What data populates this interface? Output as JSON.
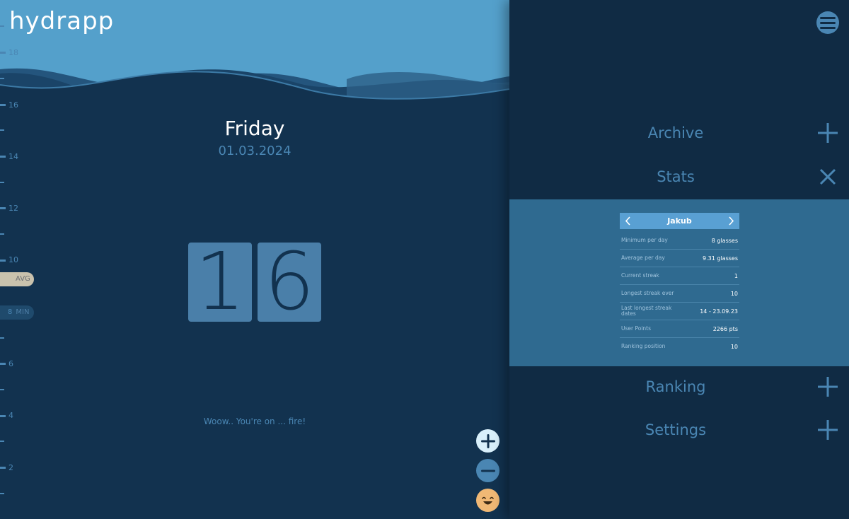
{
  "app": {
    "logo": "hydrapp"
  },
  "ruler": {
    "labels": [
      "18",
      "16",
      "14",
      "12",
      "10",
      "8",
      "6",
      "4",
      "2"
    ],
    "avg_label": "AVG",
    "min_label": "MIN"
  },
  "main": {
    "day": "Friday",
    "date": "01.03.2024",
    "count_digits": [
      "1",
      "6"
    ],
    "message": "Woow.. You're on ... fire!"
  },
  "actions": {
    "add_icon": "plus-icon",
    "remove_icon": "minus-icon",
    "mood_icon": "smiley-icon"
  },
  "menu": {
    "items": [
      {
        "label": "Archive",
        "icon": "plus-icon"
      },
      {
        "label": "Stats",
        "icon": "close-icon"
      },
      {
        "label": "Ranking",
        "icon": "plus-icon"
      },
      {
        "label": "Settings",
        "icon": "plus-icon"
      }
    ]
  },
  "stats": {
    "user": "Jakub",
    "rows": [
      {
        "key": "Minimum per day",
        "value": "8 glasses"
      },
      {
        "key": "Average per day",
        "value": "9.31 glasses"
      },
      {
        "key": "Current streak",
        "value": "1"
      },
      {
        "key": "Longest streak ever",
        "value": "10"
      },
      {
        "key": "Last longest streak dates",
        "value": "14 - 23.09.23"
      },
      {
        "key": "User Points",
        "value": "2266 pts"
      },
      {
        "key": "Ranking position",
        "value": "10"
      }
    ]
  },
  "colors": {
    "background": "#12324f",
    "panel": "#102b44",
    "accent": "#4a86b3",
    "wave_light": "#54a0cb",
    "stats_bg": "#2f6a90"
  }
}
